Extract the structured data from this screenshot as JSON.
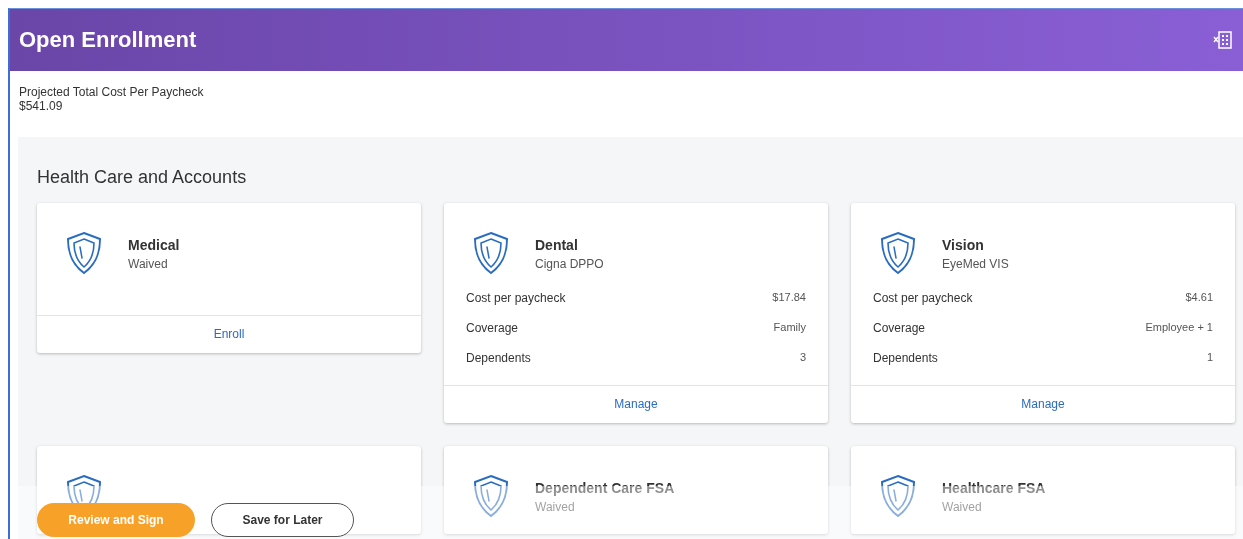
{
  "header": {
    "title": "Open Enrollment"
  },
  "summary": {
    "label": "Projected Total Cost Per Paycheck",
    "value": "$541.09"
  },
  "section": {
    "title": "Health Care and Accounts",
    "cards": [
      {
        "kind": "benefit",
        "name": "Medical",
        "subtitle": "Waived",
        "action": "Enroll"
      },
      {
        "kind": "benefit",
        "name": "Dental",
        "subtitle": "Cigna DPPO",
        "details": [
          {
            "label": "Cost per paycheck",
            "value": "$17.84"
          },
          {
            "label": "Coverage",
            "value": "Family"
          },
          {
            "label": "Dependents",
            "value": "3"
          }
        ],
        "action": "Manage"
      },
      {
        "kind": "benefit",
        "name": "Vision",
        "subtitle": "EyeMed VIS",
        "details": [
          {
            "label": "Cost per paycheck",
            "value": "$4.61"
          },
          {
            "label": "Coverage",
            "value": "Employee + 1"
          },
          {
            "label": "Dependents",
            "value": "1"
          }
        ],
        "action": "Manage"
      },
      {
        "kind": "obscured"
      },
      {
        "kind": "benefit",
        "name": "Dependent Care FSA",
        "subtitle": "Waived"
      },
      {
        "kind": "benefit",
        "name": "Healthcare FSA",
        "subtitle": "Waived"
      }
    ]
  },
  "footer": {
    "buttons": [
      {
        "label": "Review and Sign",
        "kind": "primary"
      },
      {
        "label": "Save for Later",
        "kind": "secondary"
      }
    ]
  }
}
